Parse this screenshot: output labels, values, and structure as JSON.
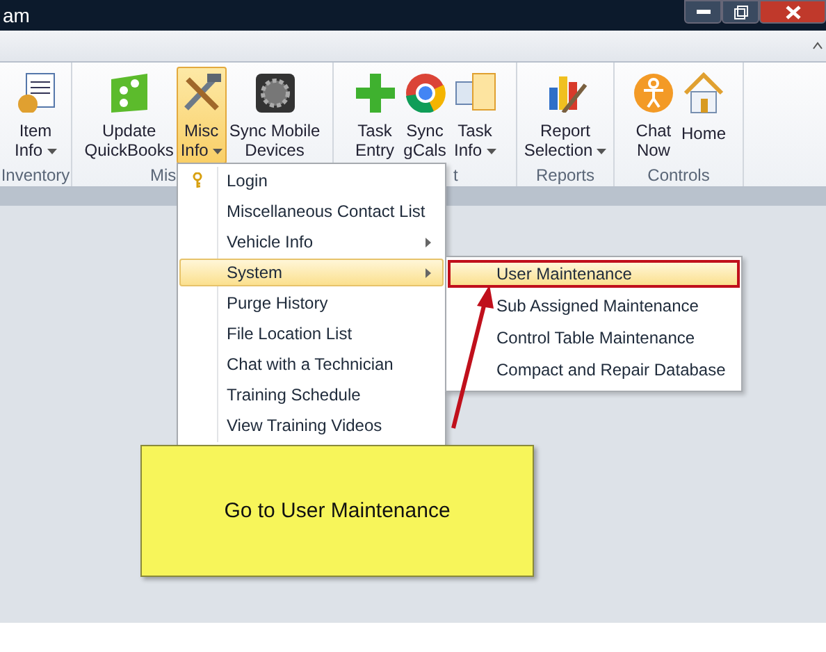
{
  "window": {
    "title": "am"
  },
  "ribbon": {
    "groups": [
      {
        "label": "Inventory",
        "buttons": [
          {
            "lines": [
              "Item",
              "Info"
            ],
            "dropdown": true,
            "selected": false
          }
        ]
      },
      {
        "label": "Mis",
        "buttons": [
          {
            "lines": [
              "Update",
              "QuickBooks"
            ],
            "dropdown": false,
            "selected": false
          },
          {
            "lines": [
              "Misc",
              "Info"
            ],
            "dropdown": true,
            "selected": true
          },
          {
            "lines": [
              "Sync Mobile",
              "Devices"
            ],
            "dropdown": false,
            "selected": false
          }
        ]
      },
      {
        "label": "t",
        "buttons": [
          {
            "lines": [
              "Task",
              "Entry"
            ],
            "dropdown": false,
            "selected": false
          },
          {
            "lines": [
              "Sync",
              "gCals"
            ],
            "dropdown": false,
            "selected": false
          },
          {
            "lines": [
              "Task",
              "Info"
            ],
            "dropdown": true,
            "selected": false
          }
        ]
      },
      {
        "label": "Reports",
        "buttons": [
          {
            "lines": [
              "Report",
              "Selection"
            ],
            "dropdown": true,
            "selected": false
          }
        ]
      },
      {
        "label": "Controls",
        "buttons": [
          {
            "lines": [
              "Chat",
              "Now"
            ],
            "dropdown": false,
            "selected": false
          },
          {
            "lines": [
              "Home"
            ],
            "dropdown": false,
            "selected": false
          }
        ]
      }
    ]
  },
  "menu": [
    {
      "label": "Login",
      "submenu": false,
      "selected": false
    },
    {
      "label": "Miscellaneous Contact List",
      "submenu": false,
      "selected": false
    },
    {
      "label": "Vehicle Info",
      "submenu": true,
      "selected": false
    },
    {
      "label": "System",
      "submenu": true,
      "selected": true
    },
    {
      "label": "Purge History",
      "submenu": false,
      "selected": false
    },
    {
      "label": "File Location List",
      "submenu": false,
      "selected": false
    },
    {
      "label": "Chat with a Technician",
      "submenu": false,
      "selected": false
    },
    {
      "label": "Training Schedule",
      "submenu": false,
      "selected": false
    },
    {
      "label": "View Training Videos",
      "submenu": false,
      "selected": false
    }
  ],
  "submenu": [
    {
      "label": "User Maintenance",
      "selected": true
    },
    {
      "label": "Sub Assigned Maintenance",
      "selected": false
    },
    {
      "label": "Control Table Maintenance",
      "selected": false
    },
    {
      "label": "Compact and Repair Database",
      "selected": false
    }
  ],
  "callout": {
    "text": "Go to User Maintenance"
  }
}
